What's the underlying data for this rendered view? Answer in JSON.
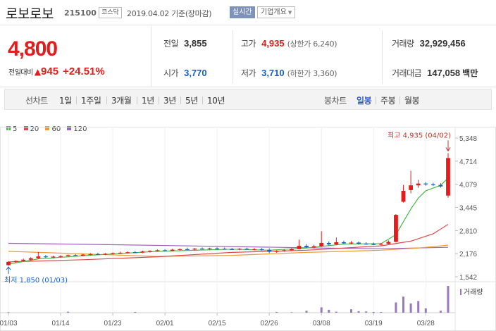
{
  "header": {
    "name": "로보로보",
    "code": "215100",
    "market": "코스닥",
    "date_text": "2019.04.02 기준(장마감)",
    "live_badge": "실시간",
    "company_button": "기업개요"
  },
  "summary": {
    "price": "4,800",
    "change_label": "전일대비",
    "change_value": "945",
    "change_pct": "+24.51%",
    "prev_close": {
      "label": "전일",
      "value": "3,855"
    },
    "high": {
      "label": "고가",
      "value": "4,935",
      "note": "(상한가 6,240)"
    },
    "volume": {
      "label": "거래량",
      "value": "32,929,456"
    },
    "open": {
      "label": "시가",
      "value": "3,770"
    },
    "low": {
      "label": "저가",
      "value": "3,710",
      "note": "(하한가 3,360)"
    },
    "amount": {
      "label": "거래대금",
      "value": "147,058",
      "unit": "백만"
    }
  },
  "tabs": {
    "line_label": "선차트",
    "line_items": [
      "1일",
      "1주일",
      "3개월",
      "1년",
      "3년",
      "5년",
      "10년"
    ],
    "candle_label": "봉차트",
    "candle_items": [
      "일봉",
      "주봉",
      "월봉"
    ],
    "candle_active": "일봉"
  },
  "colors": {
    "up": "#e31c1c",
    "down": "#1861c5",
    "ma5": "#48b848",
    "ma20": "#e04848",
    "ma60": "#f09a30",
    "ma120": "#a060c0",
    "volume": "#9a78c0"
  },
  "chart_data": {
    "type": "candlestick",
    "legend": [
      {
        "name": "5",
        "color": "#48b848"
      },
      {
        "name": "20",
        "color": "#e04848"
      },
      {
        "name": "60",
        "color": "#f09a30"
      },
      {
        "name": "120",
        "color": "#a060c0"
      }
    ],
    "y_ticks": [
      "5,348",
      "4,714",
      "4,079",
      "3,445",
      "2,810",
      "2,176",
      "1,542"
    ],
    "x_ticks": [
      "01/03",
      "01/14",
      "01/23",
      "02/01",
      "02/15",
      "02/26",
      "03/08",
      "03/19",
      "03/28"
    ],
    "ylim": [
      1542,
      5348
    ],
    "high_annotation": "최고 4,935 (04/02)",
    "low_annotation": "최저 1,850 (01/03)",
    "volume_label": "거래량",
    "candles": [
      {
        "date": "01/03",
        "o": 1860,
        "h": 1970,
        "l": 1850,
        "c": 1950
      },
      {
        "date": "01/04",
        "o": 1950,
        "h": 1990,
        "l": 1920,
        "c": 1975
      },
      {
        "date": "01/07",
        "o": 1975,
        "h": 2040,
        "l": 1960,
        "c": 2010
      },
      {
        "date": "01/08",
        "o": 2010,
        "h": 2080,
        "l": 1990,
        "c": 2050
      },
      {
        "date": "01/09",
        "o": 2050,
        "h": 2220,
        "l": 2030,
        "c": 2100
      },
      {
        "date": "01/10",
        "o": 2100,
        "h": 2140,
        "l": 2060,
        "c": 2080
      },
      {
        "date": "01/11",
        "o": 2080,
        "h": 2120,
        "l": 2050,
        "c": 2095
      },
      {
        "date": "01/14",
        "o": 2095,
        "h": 2130,
        "l": 2070,
        "c": 2110
      },
      {
        "date": "01/15",
        "o": 2110,
        "h": 2150,
        "l": 2090,
        "c": 2135
      },
      {
        "date": "01/16",
        "o": 2135,
        "h": 2160,
        "l": 2110,
        "c": 2120
      },
      {
        "date": "01/17",
        "o": 2120,
        "h": 2170,
        "l": 2105,
        "c": 2150
      },
      {
        "date": "01/18",
        "o": 2150,
        "h": 2190,
        "l": 2130,
        "c": 2165
      },
      {
        "date": "01/21",
        "o": 2165,
        "h": 2200,
        "l": 2140,
        "c": 2150
      },
      {
        "date": "01/22",
        "o": 2150,
        "h": 2190,
        "l": 2135,
        "c": 2175
      },
      {
        "date": "01/23",
        "o": 2175,
        "h": 2210,
        "l": 2150,
        "c": 2190
      },
      {
        "date": "01/24",
        "o": 2190,
        "h": 2230,
        "l": 2170,
        "c": 2200
      },
      {
        "date": "01/25",
        "o": 2200,
        "h": 2240,
        "l": 2180,
        "c": 2215
      },
      {
        "date": "01/28",
        "o": 2215,
        "h": 2250,
        "l": 2190,
        "c": 2205
      },
      {
        "date": "01/29",
        "o": 2205,
        "h": 2260,
        "l": 2190,
        "c": 2235
      },
      {
        "date": "01/30",
        "o": 2235,
        "h": 2270,
        "l": 2210,
        "c": 2250
      },
      {
        "date": "01/31",
        "o": 2250,
        "h": 2290,
        "l": 2230,
        "c": 2270
      },
      {
        "date": "02/01",
        "o": 2270,
        "h": 2300,
        "l": 2240,
        "c": 2255
      },
      {
        "date": "02/07",
        "o": 2255,
        "h": 2310,
        "l": 2240,
        "c": 2285
      },
      {
        "date": "02/08",
        "o": 2285,
        "h": 2320,
        "l": 2260,
        "c": 2300
      },
      {
        "date": "02/11",
        "o": 2300,
        "h": 2340,
        "l": 2280,
        "c": 2290
      },
      {
        "date": "02/12",
        "o": 2290,
        "h": 2330,
        "l": 2270,
        "c": 2315
      },
      {
        "date": "02/13",
        "o": 2315,
        "h": 2345,
        "l": 2290,
        "c": 2305
      },
      {
        "date": "02/14",
        "o": 2305,
        "h": 2340,
        "l": 2285,
        "c": 2320
      },
      {
        "date": "02/15",
        "o": 2320,
        "h": 2350,
        "l": 2295,
        "c": 2310
      },
      {
        "date": "02/18",
        "o": 2310,
        "h": 2345,
        "l": 2290,
        "c": 2300
      },
      {
        "date": "02/19",
        "o": 2300,
        "h": 2335,
        "l": 2275,
        "c": 2290
      },
      {
        "date": "02/20",
        "o": 2290,
        "h": 2330,
        "l": 2270,
        "c": 2310
      },
      {
        "date": "02/21",
        "o": 2310,
        "h": 2340,
        "l": 2280,
        "c": 2295
      },
      {
        "date": "02/22",
        "o": 2295,
        "h": 2330,
        "l": 2270,
        "c": 2300
      },
      {
        "date": "02/25",
        "o": 2300,
        "h": 2330,
        "l": 2260,
        "c": 2280
      },
      {
        "date": "02/26",
        "o": 2280,
        "h": 2320,
        "l": 2190,
        "c": 2230
      },
      {
        "date": "02/27",
        "o": 2230,
        "h": 2270,
        "l": 2200,
        "c": 2250
      },
      {
        "date": "02/28",
        "o": 2250,
        "h": 2300,
        "l": 2230,
        "c": 2270
      },
      {
        "date": "03/04",
        "o": 2270,
        "h": 2330,
        "l": 2250,
        "c": 2300
      },
      {
        "date": "03/05",
        "o": 2300,
        "h": 2560,
        "l": 2290,
        "c": 2390
      },
      {
        "date": "03/06",
        "o": 2390,
        "h": 2440,
        "l": 2330,
        "c": 2350
      },
      {
        "date": "03/07",
        "o": 2350,
        "h": 2420,
        "l": 2320,
        "c": 2380
      },
      {
        "date": "03/08",
        "o": 2380,
        "h": 2790,
        "l": 2360,
        "c": 2470
      },
      {
        "date": "03/11",
        "o": 2470,
        "h": 2510,
        "l": 2400,
        "c": 2430
      },
      {
        "date": "03/12",
        "o": 2430,
        "h": 2620,
        "l": 2410,
        "c": 2490
      },
      {
        "date": "03/13",
        "o": 2490,
        "h": 2530,
        "l": 2440,
        "c": 2460
      },
      {
        "date": "03/14",
        "o": 2460,
        "h": 2520,
        "l": 2430,
        "c": 2480
      },
      {
        "date": "03/15",
        "o": 2480,
        "h": 2510,
        "l": 2420,
        "c": 2450
      },
      {
        "date": "03/18",
        "o": 2450,
        "h": 2490,
        "l": 2420,
        "c": 2440
      },
      {
        "date": "03/19",
        "o": 2440,
        "h": 2480,
        "l": 2410,
        "c": 2430
      },
      {
        "date": "03/20",
        "o": 2430,
        "h": 2470,
        "l": 2400,
        "c": 2445
      },
      {
        "date": "03/21",
        "o": 2445,
        "h": 2540,
        "l": 2440,
        "c": 2500
      },
      {
        "date": "03/22",
        "o": 2500,
        "h": 3260,
        "l": 2480,
        "c": 3240
      },
      {
        "date": "03/25",
        "o": 3600,
        "h": 4060,
        "l": 3580,
        "c": 3900
      },
      {
        "date": "03/26",
        "o": 3920,
        "h": 4450,
        "l": 3830,
        "c": 4050
      },
      {
        "date": "03/27",
        "o": 4050,
        "h": 4200,
        "l": 3980,
        "c": 4100
      },
      {
        "date": "03/28",
        "o": 4100,
        "h": 4140,
        "l": 4040,
        "c": 4080
      },
      {
        "date": "03/29",
        "o": 4080,
        "h": 4120,
        "l": 4030,
        "c": 4060
      },
      {
        "date": "04/01",
        "o": 4060,
        "h": 4110,
        "l": 3990,
        "c": 4020
      },
      {
        "date": "04/02",
        "o": 3770,
        "h": 4935,
        "l": 3710,
        "c": 4800
      }
    ],
    "ma5": [
      [
        0,
        1890
      ],
      [
        4,
        2030
      ],
      [
        10,
        2120
      ],
      [
        20,
        2240
      ],
      [
        30,
        2300
      ],
      [
        35,
        2270
      ],
      [
        40,
        2330
      ],
      [
        45,
        2440
      ],
      [
        50,
        2450
      ],
      [
        52,
        2700
      ],
      [
        53,
        3050
      ],
      [
        54,
        3400
      ],
      [
        55,
        3700
      ],
      [
        56,
        3900
      ],
      [
        58,
        4050
      ],
      [
        59,
        4250
      ]
    ],
    "ma20": [
      [
        0,
        1950
      ],
      [
        10,
        2010
      ],
      [
        20,
        2090
      ],
      [
        30,
        2210
      ],
      [
        40,
        2270
      ],
      [
        50,
        2390
      ],
      [
        54,
        2520
      ],
      [
        57,
        2720
      ],
      [
        59,
        2980
      ]
    ],
    "ma60": [
      [
        0,
        2240
      ],
      [
        10,
        2170
      ],
      [
        20,
        2100
      ],
      [
        30,
        2130
      ],
      [
        40,
        2210
      ],
      [
        50,
        2270
      ],
      [
        55,
        2330
      ],
      [
        59,
        2410
      ]
    ],
    "ma120": [
      [
        0,
        2460
      ],
      [
        15,
        2420
      ],
      [
        30,
        2370
      ],
      [
        42,
        2330
      ],
      [
        50,
        2310
      ],
      [
        59,
        2350
      ]
    ],
    "volume": [
      {
        "i": 0,
        "v": 2
      },
      {
        "i": 8,
        "v": 4
      },
      {
        "i": 17,
        "v": 3
      },
      {
        "i": 36,
        "v": 3
      },
      {
        "i": 38,
        "v": 2
      },
      {
        "i": 40,
        "v": 8
      },
      {
        "i": 42,
        "v": 22
      },
      {
        "i": 43,
        "v": 12
      },
      {
        "i": 44,
        "v": 4
      },
      {
        "i": 46,
        "v": 14
      },
      {
        "i": 47,
        "v": 6
      },
      {
        "i": 48,
        "v": 5
      },
      {
        "i": 49,
        "v": 3
      },
      {
        "i": 50,
        "v": 3
      },
      {
        "i": 52,
        "v": 42
      },
      {
        "i": 53,
        "v": 66
      },
      {
        "i": 54,
        "v": 38
      },
      {
        "i": 55,
        "v": 48
      },
      {
        "i": 56,
        "v": 18
      },
      {
        "i": 58,
        "v": 8
      },
      {
        "i": 59,
        "v": 110
      }
    ],
    "volume_max": 110
  }
}
